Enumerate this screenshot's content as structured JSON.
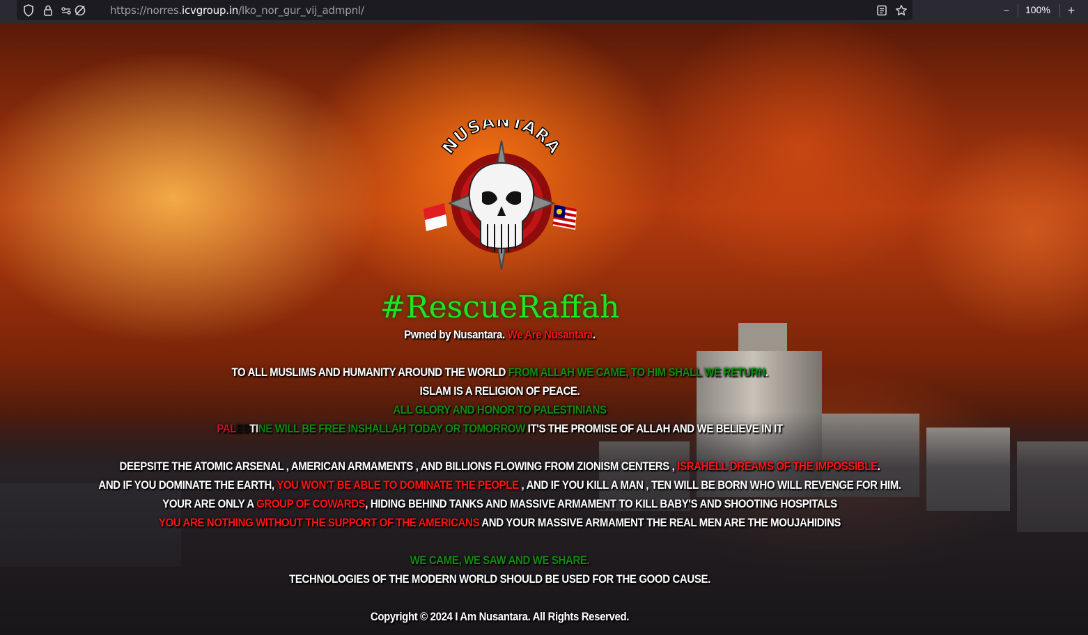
{
  "browser": {
    "url_prefix": "https://norres.",
    "url_host": "icvgroup.in",
    "url_path": "/lko_nor_gur_vij_admpnl/",
    "zoom": "100%",
    "zoom_out": "−",
    "zoom_in": "+"
  },
  "logo": {
    "text": "NUSANTARA"
  },
  "page": {
    "hashtag": "#RescueRaffah",
    "pwned_prefix": "Pwned by Nusantara.",
    "pwned_red": "We Are Nusantara",
    "pwned_suffix": ".",
    "l1_white": "TO ALL MUSLIMS AND HUMANITY AROUND THE WORLD",
    "l1_green": "FROM ALLAH WE CAME, TO HIM SHALL WE RETURN",
    "l1_end": ".",
    "l2": "ISLAM IS A RELIGION OF PEACE.",
    "l3": "ALL GLORY AND HONOR TO PALESTINIANS",
    "l4_pal1": "PAL",
    "l4_pal2": "ES",
    "l4_pal3": "TI",
    "l4_pal4": "NE",
    "l4_green": "WILL BE FREE INSHALLAH TODAY OR TOMORROW",
    "l4_white": "IT'S THE PROMISE OF ALLAH AND WE BELIEVE IN IT",
    "l5_white": "DEEPSITE THE ATOMIC ARSENAL , AMERICAN ARMAMENTS , AND BILLIONS FLOWING FROM ZIONISM CENTERS ,",
    "l5_red": "ISRAHELL DREAMS OF THE IMPOSSIBLE",
    "l5_end": ".",
    "l6_white1": "AND IF YOU DOMINATE THE EARTH,",
    "l6_red": "YOU WON'T BE ABLE TO DOMINATE THE PEOPLE",
    "l6_white2": ", AND IF YOU KILL A MAN , TEN WILL BE BORN WHO WILL REVENGE FOR HIM.",
    "l7_white1": "YOUR ARE ONLY A",
    "l7_red": "GROUP OF COWARDS",
    "l7_white2": ", HIDING BEHIND TANKS AND MASSIVE ARMAMENT TO KILL BABY'S AND SHOOTING HOSPITALS",
    "l8_red": "YOU ARE NOTHING WITHOUT THE SUPPORT OF THE AMERICANS",
    "l8_white": "AND YOUR MASSIVE ARMAMENT THE REAL MEN ARE THE MOUJAHIDINS",
    "l9": "WE CAME, WE SAW AND WE SHARE.",
    "l10": "TECHNOLOGIES OF THE MODERN WORLD SHOULD BE USED FOR THE GOOD CAUSE.",
    "copyright": "Copyright © 2024 I Am Nusantara. All Rights Reserved."
  },
  "colors": {
    "accent_green": "#21e321",
    "dark_green": "#118c11",
    "red": "#ff1212"
  }
}
